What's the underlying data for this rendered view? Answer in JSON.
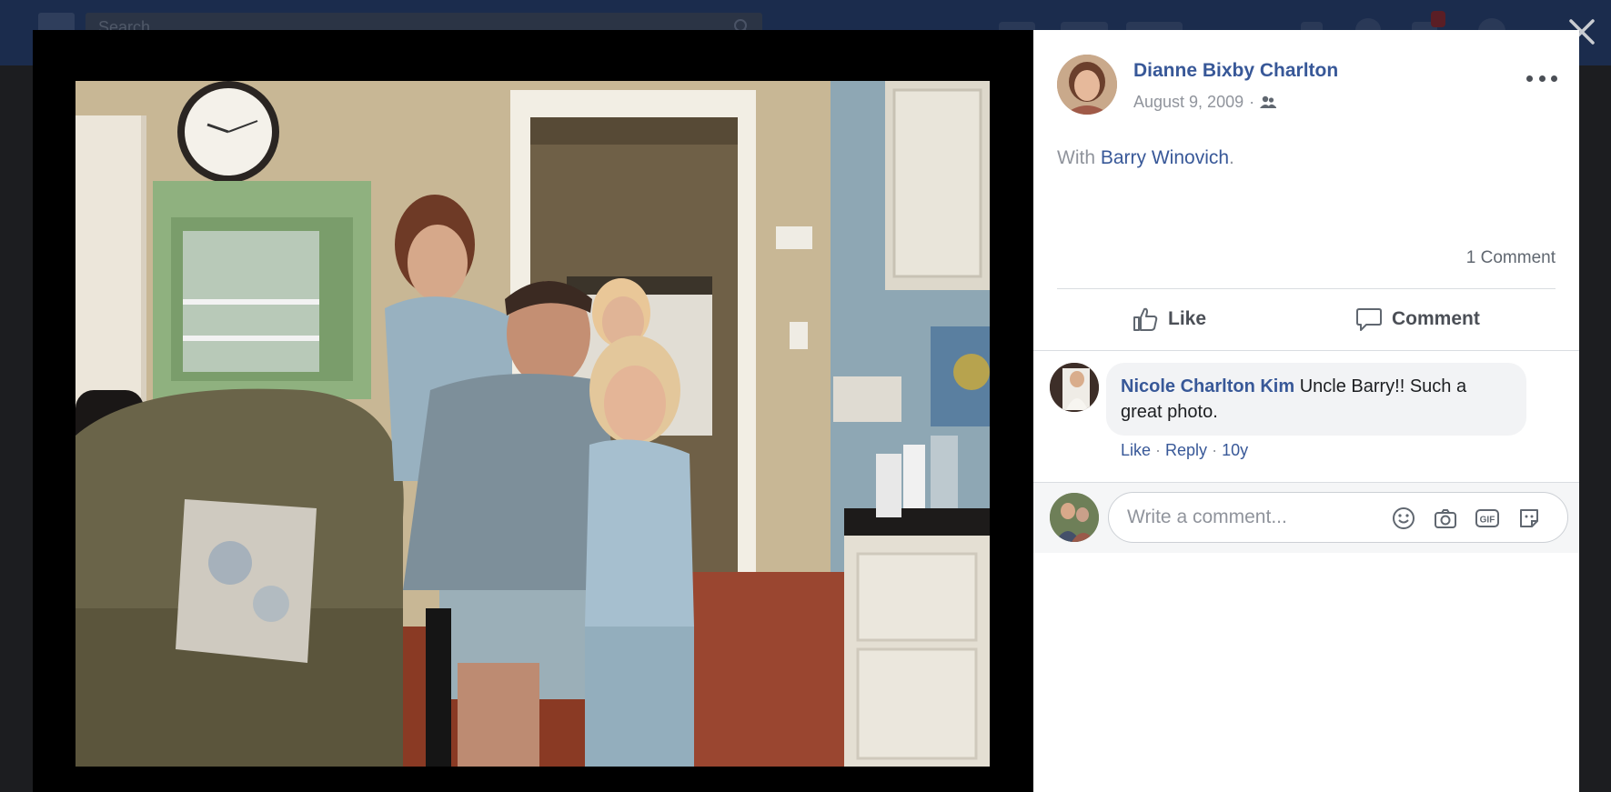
{
  "topbar": {
    "search_placeholder": "Search"
  },
  "post": {
    "author_name": "Dianne Bixby Charlton",
    "date": "August 9, 2009",
    "meta_separator": "·",
    "audience_icon": "friends-icon",
    "with_prefix": "With ",
    "tagged_person": "Barry Winovich",
    "with_suffix": ".",
    "comment_count": "1 Comment"
  },
  "actions": {
    "like_label": "Like",
    "comment_label": "Comment"
  },
  "comments": [
    {
      "author": "Nicole Charlton Kim",
      "text": " Uncle Barry!! Such a great photo.",
      "like_label": "Like",
      "reply_label": "Reply",
      "age": "10y",
      "separator": " · "
    }
  ],
  "composer": {
    "placeholder": "Write a comment...",
    "tools": [
      "emoji-icon",
      "camera-icon",
      "gif-icon",
      "sticker-icon"
    ]
  },
  "colors": {
    "link": "#385898",
    "muted": "#90949c",
    "overlay": "#1c1d20"
  }
}
